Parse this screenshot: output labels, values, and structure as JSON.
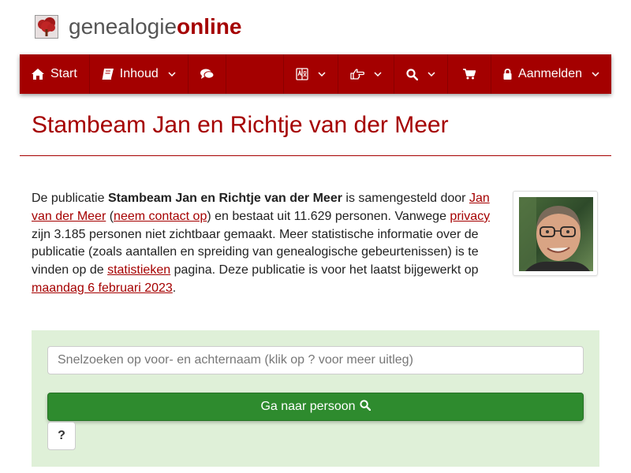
{
  "brand": {
    "part1": "genealogie",
    "part2": "online"
  },
  "nav": {
    "start": "Start",
    "contents": "Inhoud",
    "login": "Aanmelden"
  },
  "icons": {
    "logo": "family-tree-icon",
    "start": "home-icon",
    "contents": "book-icon",
    "chat": "comments-icon",
    "language": "translate-icon",
    "share": "hand-point-right-icon",
    "search": "search-icon",
    "cart": "shopping-cart-icon",
    "login": "lock-icon"
  },
  "colors": {
    "brand": "#a50000",
    "nav": "#a40000",
    "panel": "#dff0d8",
    "button": "#2e8b2e"
  },
  "page": {
    "title": "Stambeam Jan en Richtje van der Meer"
  },
  "description": {
    "t1": "De publicatie ",
    "pub_name": "Stambeam Jan en Richtje van der Meer",
    "t2": " is samengesteld door ",
    "author": "Jan van der Meer",
    "t3": " (",
    "contact": "neem contact op",
    "t4": ") en bestaat uit 11.629 personen. Vanwege ",
    "privacy": "privacy",
    "t5": " zijn 3.185 personen niet zichtbaar gemaakt. Meer statistische informatie over de publicatie (zoals aantallen en spreiding van genealogische gebeurtenissen) is te vinden op de ",
    "stats": "statistieken",
    "t6": " pagina. Deze publicatie is voor het laatst bijgewerkt op ",
    "date": "maandag 6 februari 2023",
    "t7": "."
  },
  "search": {
    "placeholder": "Snelzoeken op voor- en achternaam (klik op ? voor meer uitleg)",
    "value": "",
    "go_label": "Ga naar persoon",
    "help_label": "?"
  }
}
